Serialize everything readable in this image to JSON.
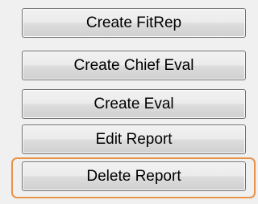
{
  "buttons": {
    "create_fitrep": "Create FitRep",
    "create_chief_eval": "Create Chief Eval",
    "create_eval": "Create Eval",
    "edit_report": "Edit Report",
    "delete_report": "Delete Report"
  },
  "colors": {
    "background": "#f0f0f0",
    "button_border": "#707070",
    "highlight": "#e8934a"
  }
}
